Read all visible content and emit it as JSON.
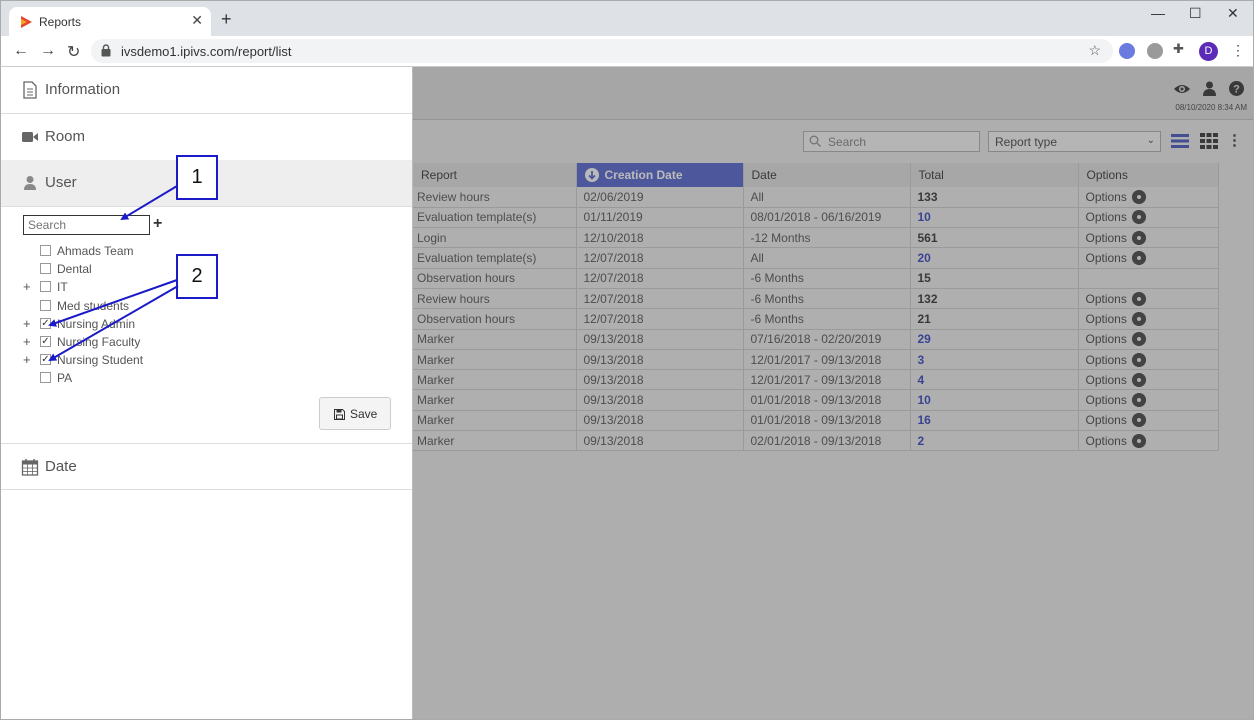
{
  "browser": {
    "tab_title": "Reports",
    "url": "ivsdemo1.ipivs.com/report/list",
    "profile_initial": "D"
  },
  "header": {
    "datetime": "08/10/2020 8:34 AM",
    "icons": [
      "eye-icon",
      "user-icon",
      "help-icon"
    ]
  },
  "toolbar": {
    "search_placeholder": "Search",
    "report_type": "Report type"
  },
  "table": {
    "columns": [
      "Report",
      "Creation Date",
      "Date",
      "Total",
      "Options"
    ],
    "sorted_column": "Creation Date",
    "options_label": "Options",
    "rows": [
      {
        "report": "Review hours",
        "created": "02/06/2019",
        "date": "All",
        "total": "133",
        "total_link": false,
        "has_options": true
      },
      {
        "report": "Evaluation template(s)",
        "created": "01/11/2019",
        "date": "08/01/2018 - 06/16/2019",
        "total": "10",
        "total_link": true,
        "has_options": true
      },
      {
        "report": "Login",
        "created": "12/10/2018",
        "date": "-12 Months",
        "total": "561",
        "total_link": false,
        "has_options": true
      },
      {
        "report": "Evaluation template(s)",
        "created": "12/07/2018",
        "date": "All",
        "total": "20",
        "total_link": true,
        "has_options": true
      },
      {
        "report": "Observation hours",
        "created": "12/07/2018",
        "date": "-6 Months",
        "total": "15",
        "total_link": false,
        "has_options": false
      },
      {
        "report": "Review hours",
        "created": "12/07/2018",
        "date": "-6 Months",
        "total": "132",
        "total_link": false,
        "has_options": true
      },
      {
        "report": "Observation hours",
        "created": "12/07/2018",
        "date": "-6 Months",
        "total": "21",
        "total_link": false,
        "has_options": true
      },
      {
        "report": "Marker",
        "created": "09/13/2018",
        "date": "07/16/2018 - 02/20/2019",
        "total": "29",
        "total_link": true,
        "has_options": true
      },
      {
        "report": "Marker",
        "created": "09/13/2018",
        "date": "12/01/2017 - 09/13/2018",
        "total": "3",
        "total_link": true,
        "has_options": true
      },
      {
        "report": "Marker",
        "created": "09/13/2018",
        "date": "12/01/2017 - 09/13/2018",
        "total": "4",
        "total_link": true,
        "has_options": true
      },
      {
        "report": "Marker",
        "created": "09/13/2018",
        "date": "01/01/2018 - 09/13/2018",
        "total": "10",
        "total_link": true,
        "has_options": true
      },
      {
        "report": "Marker",
        "created": "09/13/2018",
        "date": "01/01/2018 - 09/13/2018",
        "total": "16",
        "total_link": true,
        "has_options": true
      },
      {
        "report": "Marker",
        "created": "09/13/2018",
        "date": "02/01/2018 - 09/13/2018",
        "total": "2",
        "total_link": true,
        "has_options": true
      }
    ]
  },
  "sidebar": {
    "sections": {
      "information": "Information",
      "room": "Room",
      "user": "User",
      "date": "Date"
    },
    "user_search_placeholder": "Search",
    "groups": [
      {
        "label": "Ahmads Team",
        "checked": false,
        "expandable": false
      },
      {
        "label": "Dental",
        "checked": false,
        "expandable": false
      },
      {
        "label": "IT",
        "checked": false,
        "expandable": true
      },
      {
        "label": "Med students",
        "checked": false,
        "expandable": false
      },
      {
        "label": "Nursing Admin",
        "checked": true,
        "expandable": true
      },
      {
        "label": "Nursing Faculty",
        "checked": true,
        "expandable": true
      },
      {
        "label": "Nursing Student",
        "checked": true,
        "expandable": true
      },
      {
        "label": "PA",
        "checked": false,
        "expandable": false
      }
    ],
    "save_label": "Save"
  },
  "callouts": {
    "first": "1",
    "second": "2"
  },
  "colors": {
    "accent": "#4455cc",
    "link": "#2233bb",
    "callout_border": "#1a1ac8"
  }
}
